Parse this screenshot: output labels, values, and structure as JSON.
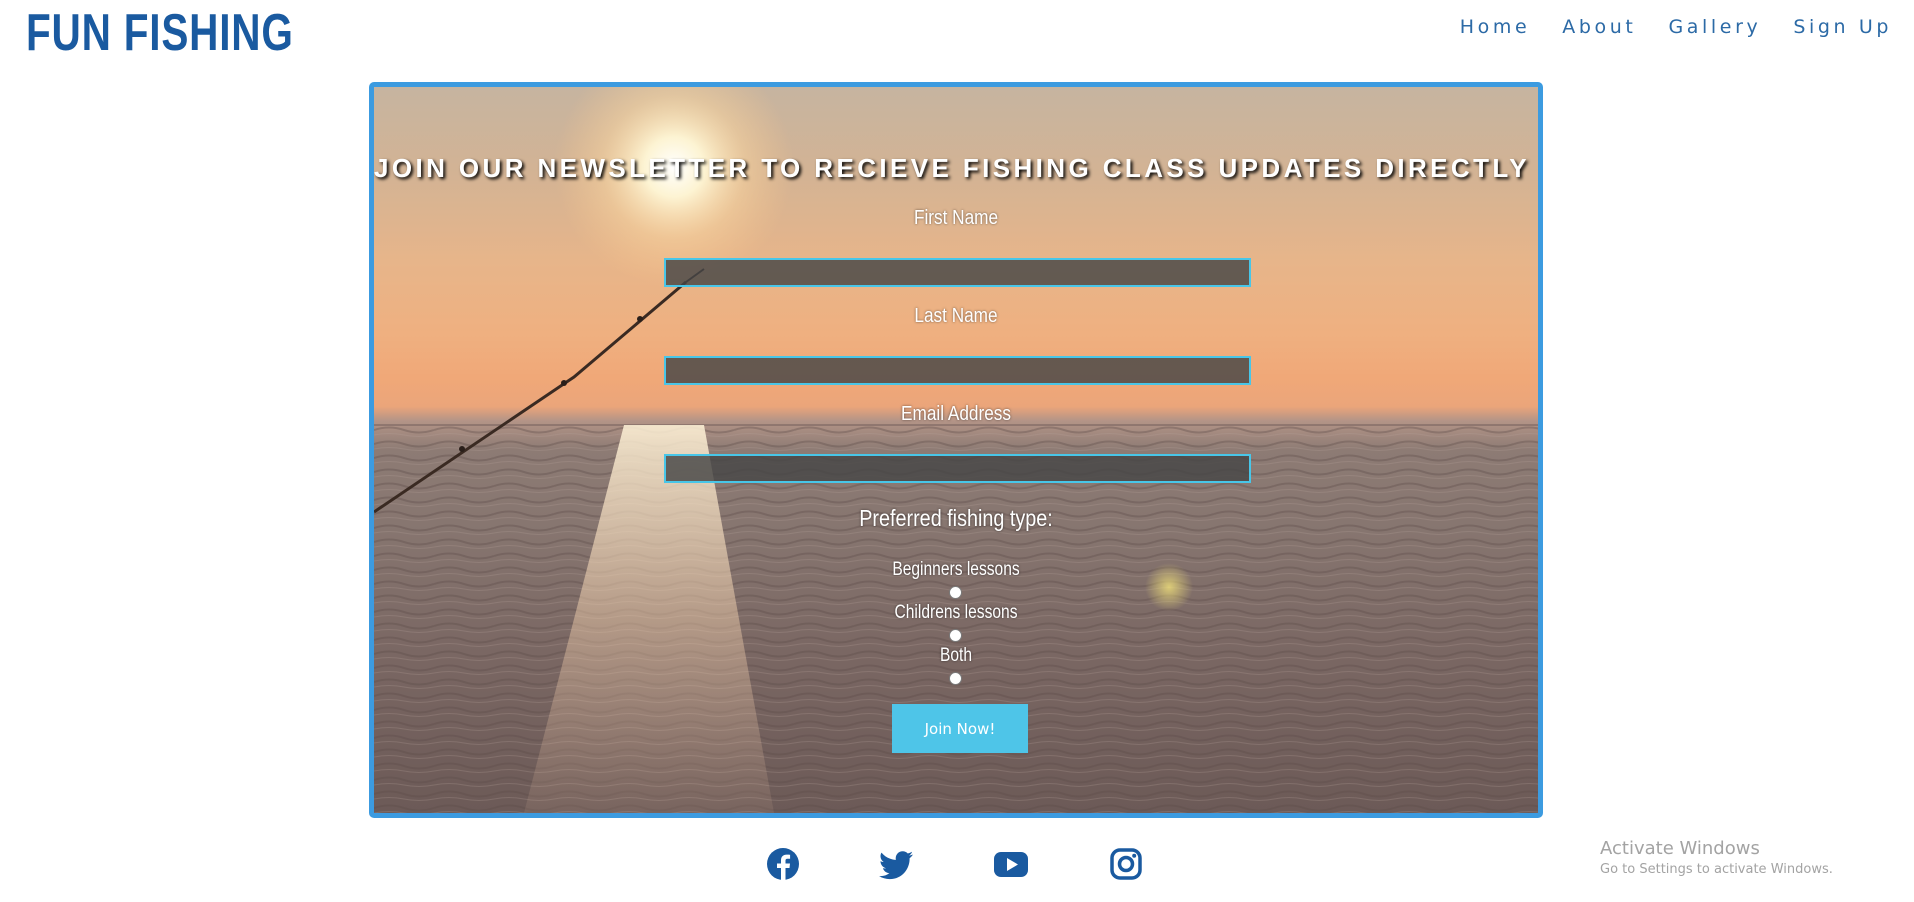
{
  "header": {
    "logo": "FUN FISHING",
    "nav": [
      "Home",
      "About",
      "Gallery",
      "Sign Up"
    ]
  },
  "newsletter": {
    "title": "JOIN OUR NEWSLETTER TO RECIEVE FISHING CLASS UPDATES DIRECTLY TO YOUR MAILBOX.",
    "fields": {
      "first_name": {
        "label": "First Name",
        "value": ""
      },
      "last_name": {
        "label": "Last Name",
        "value": ""
      },
      "email": {
        "label": "Email Address",
        "value": ""
      }
    },
    "preference": {
      "title": "Preferred fishing type:",
      "options": [
        "Beginners lessons",
        "Childrens lessons",
        "Both"
      ],
      "selected": null
    },
    "submit_label": "Join Now!"
  },
  "social": {
    "icons": [
      "facebook-icon",
      "twitter-icon",
      "youtube-icon",
      "instagram-icon"
    ],
    "color": "#1a5aa0"
  },
  "watermark": {
    "title": "Activate Windows",
    "subtitle": "Go to Settings to activate Windows."
  },
  "colors": {
    "logo": "#1a5aa0",
    "nav": "#2c6aa6",
    "panel_border": "#3c9be0",
    "input_border": "#48c6e8",
    "button": "#4ec5e8"
  }
}
